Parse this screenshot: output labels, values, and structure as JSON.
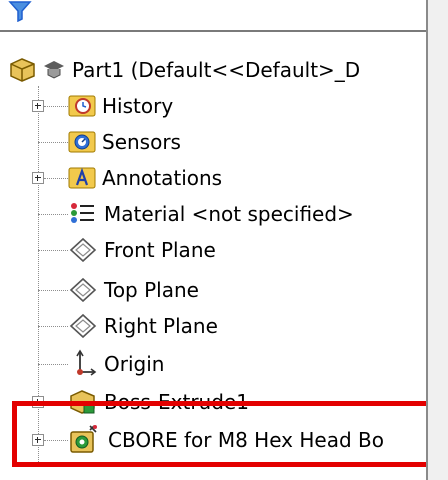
{
  "tree": {
    "items": [
      {
        "label": "Part1  (Default<<Default>_D",
        "icon": "part-icon"
      },
      {
        "label": "History",
        "icon": "history-folder-icon"
      },
      {
        "label": "Sensors",
        "icon": "sensors-folder-icon"
      },
      {
        "label": "Annotations",
        "icon": "annotations-folder-icon"
      },
      {
        "label": "Material <not specified>",
        "icon": "material-icon"
      },
      {
        "label": "Front Plane",
        "icon": "plane-icon"
      },
      {
        "label": "Top Plane",
        "icon": "plane-icon"
      },
      {
        "label": "Right Plane",
        "icon": "plane-icon"
      },
      {
        "label": "Origin",
        "icon": "origin-icon"
      },
      {
        "label": "Boss-Extrude1",
        "icon": "extrude-feature-icon"
      },
      {
        "label": "CBORE for M8 Hex Head Bo",
        "icon": "hole-wizard-feature-icon"
      }
    ]
  },
  "colors": {
    "highlight": "#e30000",
    "accent_blue": "#1f5fcf",
    "folder_yellow": "#f2c94c"
  }
}
